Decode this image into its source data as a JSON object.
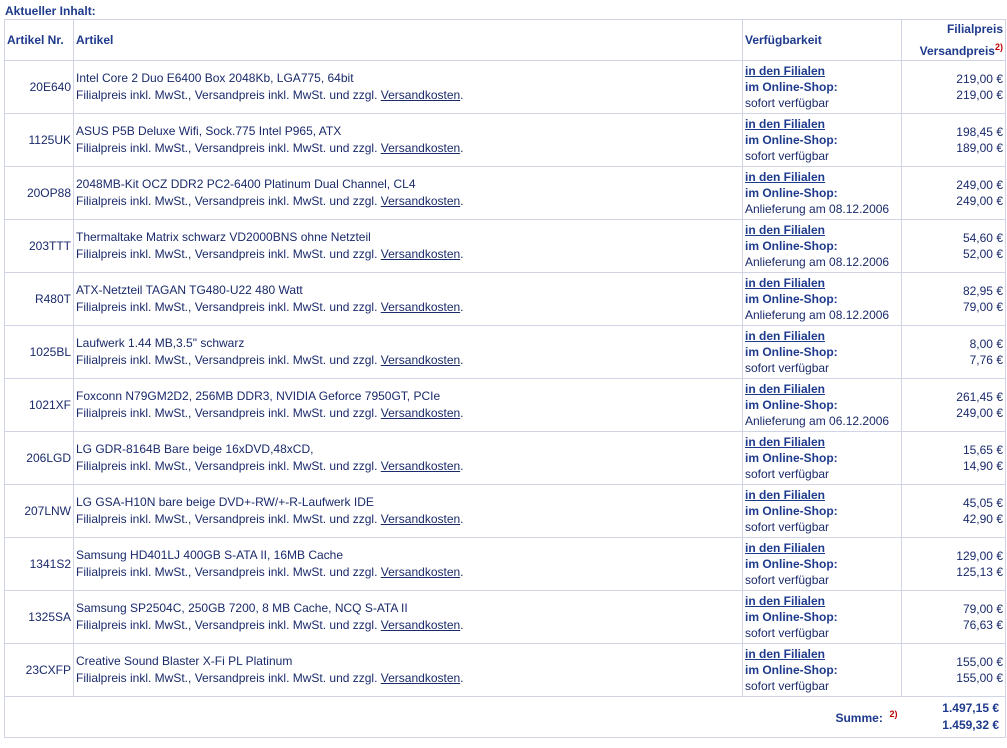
{
  "heading": "Aktueller Inhalt:",
  "columns": {
    "code": "Artikel Nr.",
    "article": "Artikel",
    "availability": "Verfügbarkeit",
    "price_store": "Filialpreis",
    "price_ship": "Versandpreis",
    "price_ship_note": "2)"
  },
  "common": {
    "price_note": "Filialpreis inkl. MwSt., Versandpreis inkl. MwSt. und zzgl.",
    "shipping_link": "Versandkosten",
    "stores_link": "in den Filialen",
    "online_label": "im Online-Shop:"
  },
  "items": [
    {
      "code": "20E640",
      "name": "Intel Core 2 Duo E6400 Box 2048Kb, LGA775, 64bit",
      "status": "sofort verfügbar",
      "store": "219,00 €",
      "ship": "219,00 €"
    },
    {
      "code": "1125UK",
      "name": "ASUS P5B Deluxe Wifi, Sock.775 Intel P965, ATX",
      "status": "sofort verfügbar",
      "store": "198,45 €",
      "ship": "189,00 €"
    },
    {
      "code": "20OP88",
      "name": "2048MB-Kit OCZ DDR2 PC2-6400 Platinum Dual Channel, CL4",
      "status": "Anlieferung am 08.12.2006",
      "store": "249,00 €",
      "ship": "249,00 €"
    },
    {
      "code": "203TTT",
      "name": "Thermaltake Matrix schwarz VD2000BNS ohne Netzteil",
      "status": "Anlieferung am 08.12.2006",
      "store": "54,60 €",
      "ship": "52,00 €"
    },
    {
      "code": "R480T",
      "name": "ATX-Netzteil TAGAN TG480-U22 480 Watt",
      "status": "Anlieferung am 08.12.2006",
      "store": "82,95 €",
      "ship": "79,00 €"
    },
    {
      "code": "1025BL",
      "name": "Laufwerk 1.44 MB,3.5\" schwarz",
      "status": "sofort verfügbar",
      "store": "8,00 €",
      "ship": "7,76 €"
    },
    {
      "code": "1021XF",
      "name": "Foxconn N79GM2D2, 256MB DDR3, NVIDIA Geforce 7950GT, PCIe",
      "status": "Anlieferung am 06.12.2006",
      "store": "261,45 €",
      "ship": "249,00 €"
    },
    {
      "code": "206LGD",
      "name": "LG GDR-8164B Bare beige 16xDVD,48xCD,",
      "status": "sofort verfügbar",
      "store": "15,65 €",
      "ship": "14,90 €"
    },
    {
      "code": "207LNW",
      "name": "LG GSA-H10N bare beige DVD+-RW/+-R-Laufwerk IDE",
      "status": "sofort verfügbar",
      "store": "45,05 €",
      "ship": "42,90 €"
    },
    {
      "code": "1341S2",
      "name": "Samsung HD401LJ 400GB S-ATA II, 16MB Cache",
      "status": "sofort verfügbar",
      "store": "129,00 €",
      "ship": "125,13 €"
    },
    {
      "code": "1325SA",
      "name": "Samsung SP2504C, 250GB 7200, 8 MB Cache, NCQ S-ATA II",
      "status": "sofort verfügbar",
      "store": "79,00 €",
      "ship": "76,63 €"
    },
    {
      "code": "23CXFP",
      "name": "Creative Sound Blaster X-Fi PL Platinum",
      "status": "sofort verfügbar",
      "store": "155,00 €",
      "ship": "155,00 €"
    }
  ],
  "summary": {
    "label": "Summe:",
    "note": "2)",
    "store_total": "1.497,15 €",
    "ship_total": "1.459,32 €"
  }
}
